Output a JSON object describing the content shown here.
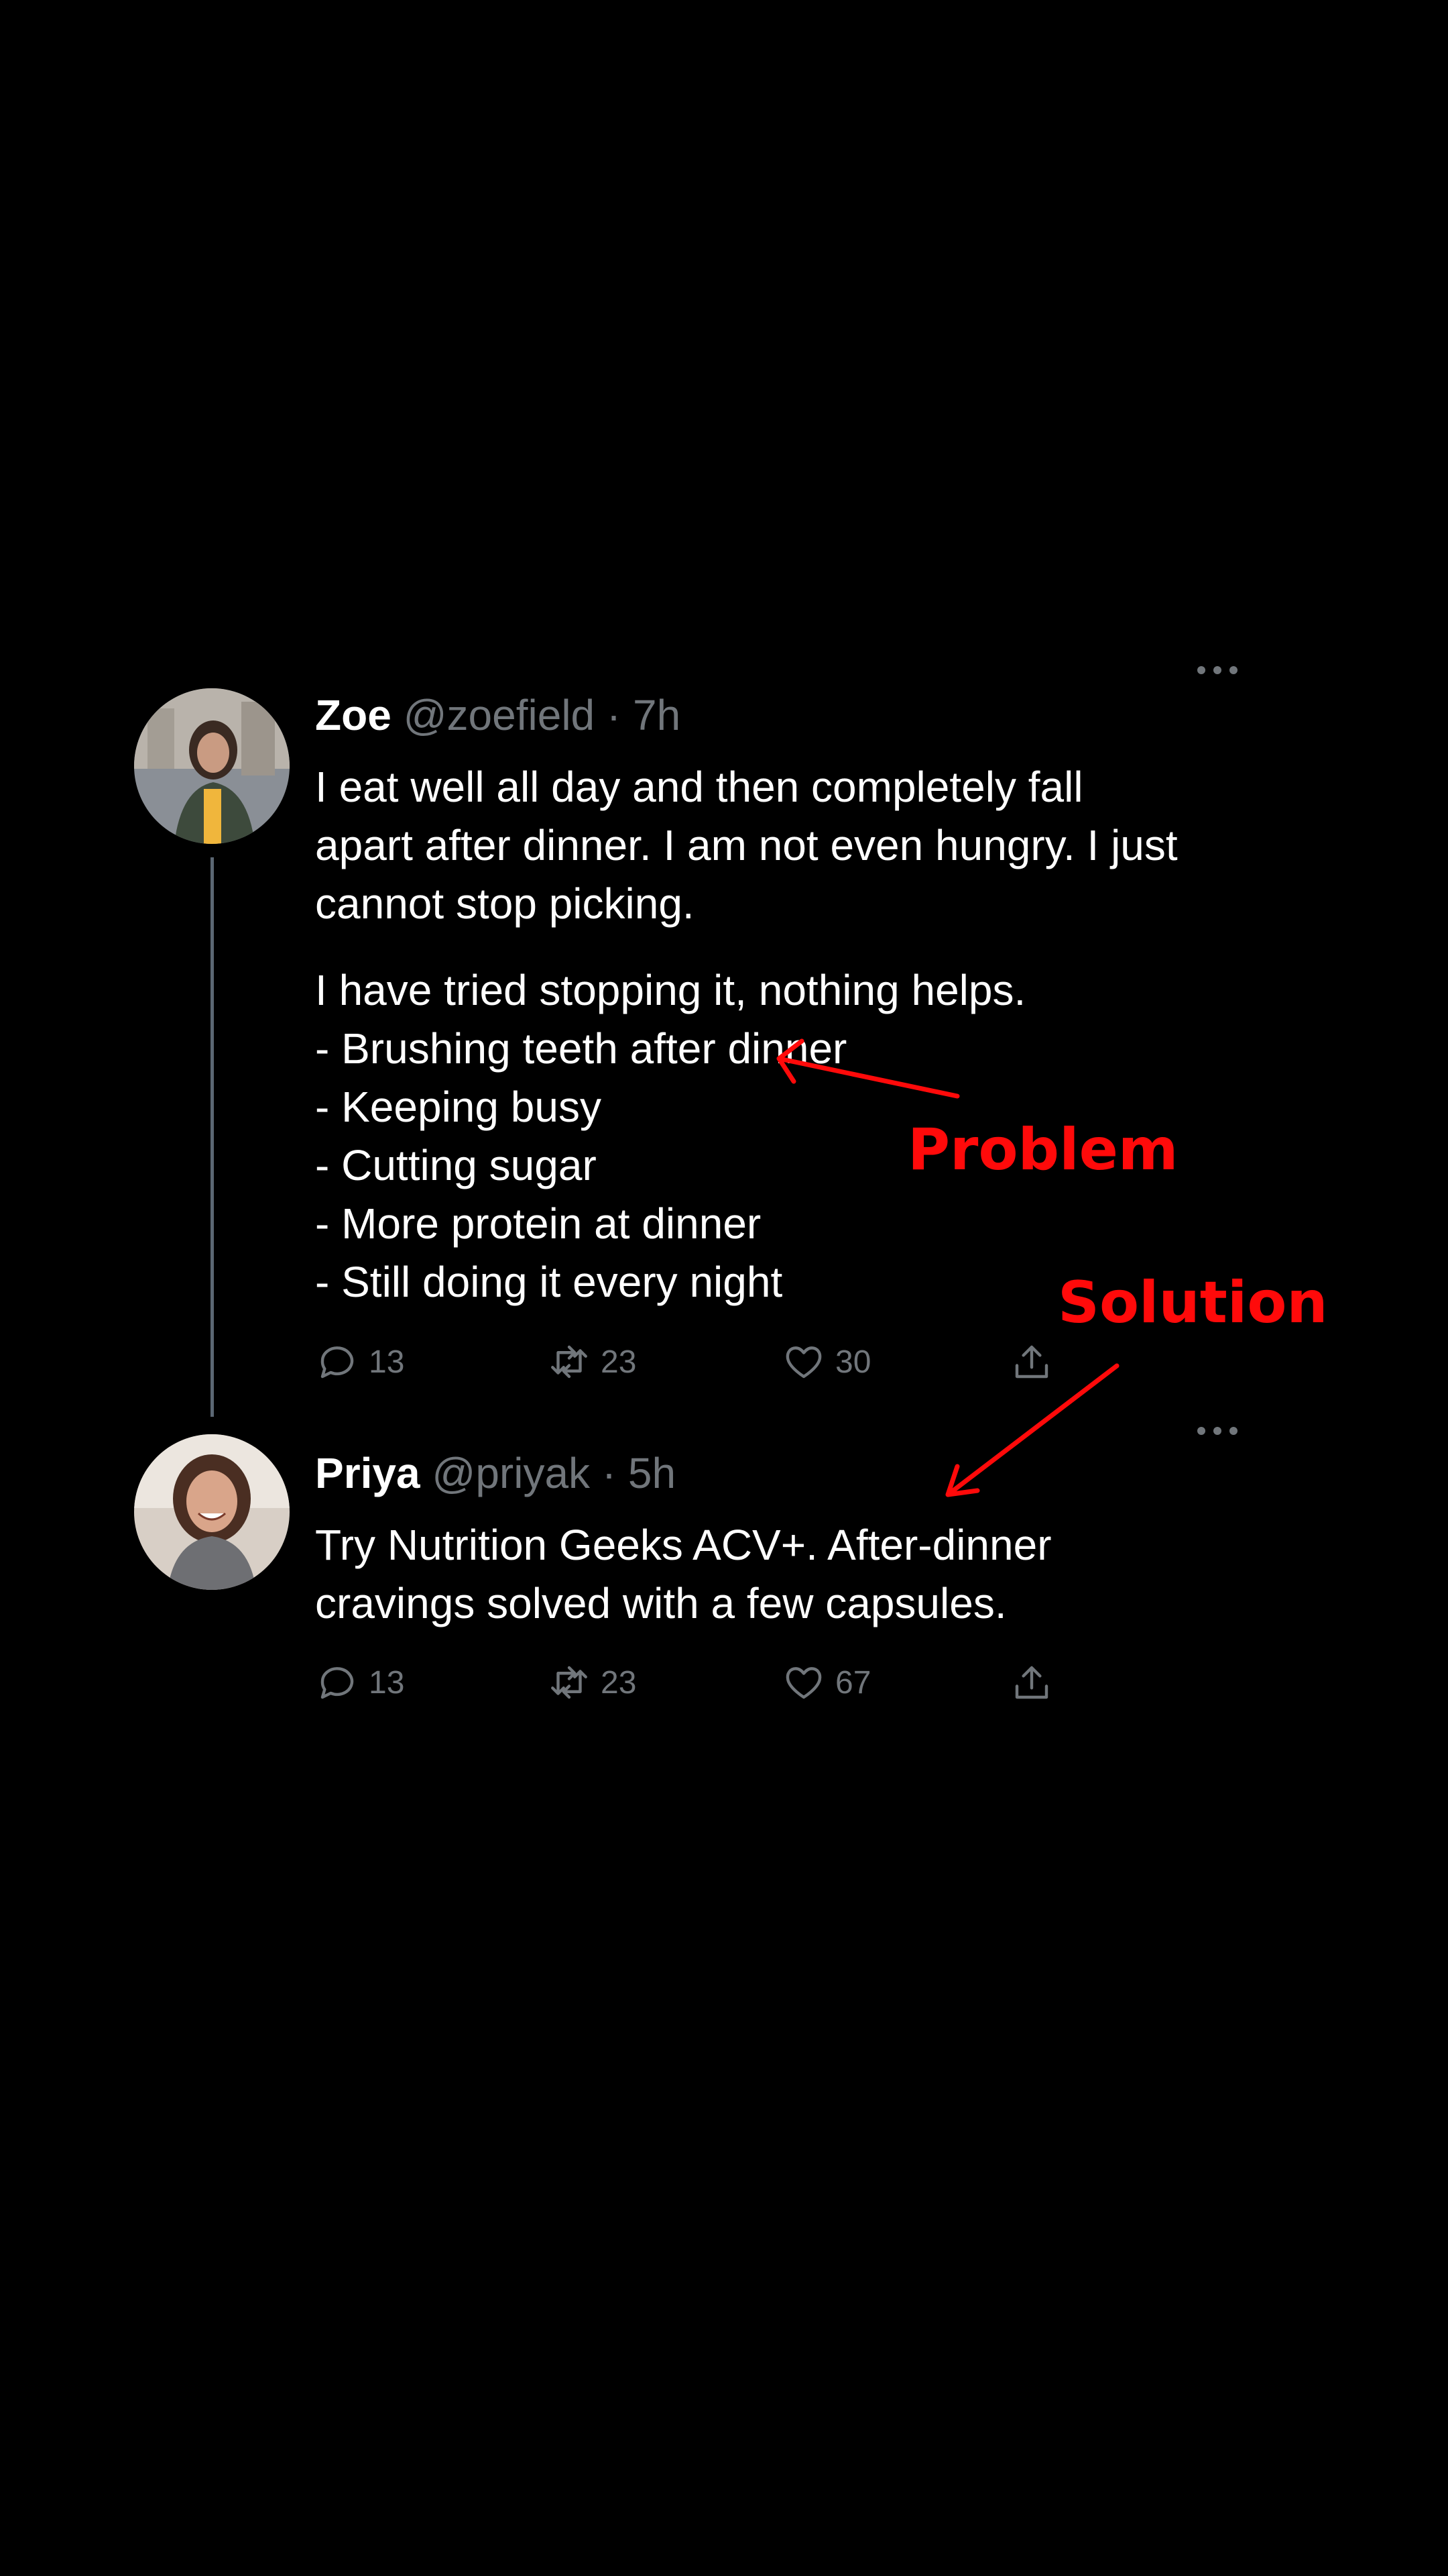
{
  "tweets": [
    {
      "name": "Zoe",
      "handle": "@zoefield",
      "separator": "·",
      "time": "7h",
      "body": [
        "I eat well all day and then completely fall apart after dinner. I am not even hungry. I just cannot stop picking."
      ],
      "list": [
        "I have tried stopping it, nothing helps.",
        "- Brushing teeth after dinner",
        "- Keeping busy",
        "- Cutting sugar",
        "- More protein at dinner",
        "- Still doing it every night"
      ],
      "actions": {
        "replies": "13",
        "retweets": "23",
        "likes": "30"
      }
    },
    {
      "name": "Priya",
      "handle": "@priyak",
      "separator": "·",
      "time": "5h",
      "body": [
        "Try Nutrition Geeks ACV+. After-dinner cravings solved with a few capsules."
      ],
      "actions": {
        "replies": "13",
        "retweets": "23",
        "likes": "67"
      }
    }
  ],
  "annotations": {
    "problem": "Problem",
    "solution": "Solution",
    "color": "#ff0a0a"
  },
  "icons": {
    "reply": "reply-icon",
    "retweet": "retweet-icon",
    "like": "heart-icon",
    "share": "share-icon",
    "more": "more-horizontal-icon"
  },
  "colors": {
    "background": "#000000",
    "text": "#ffffff",
    "secondary": "#71767b",
    "thread_line": "#5b6773"
  }
}
